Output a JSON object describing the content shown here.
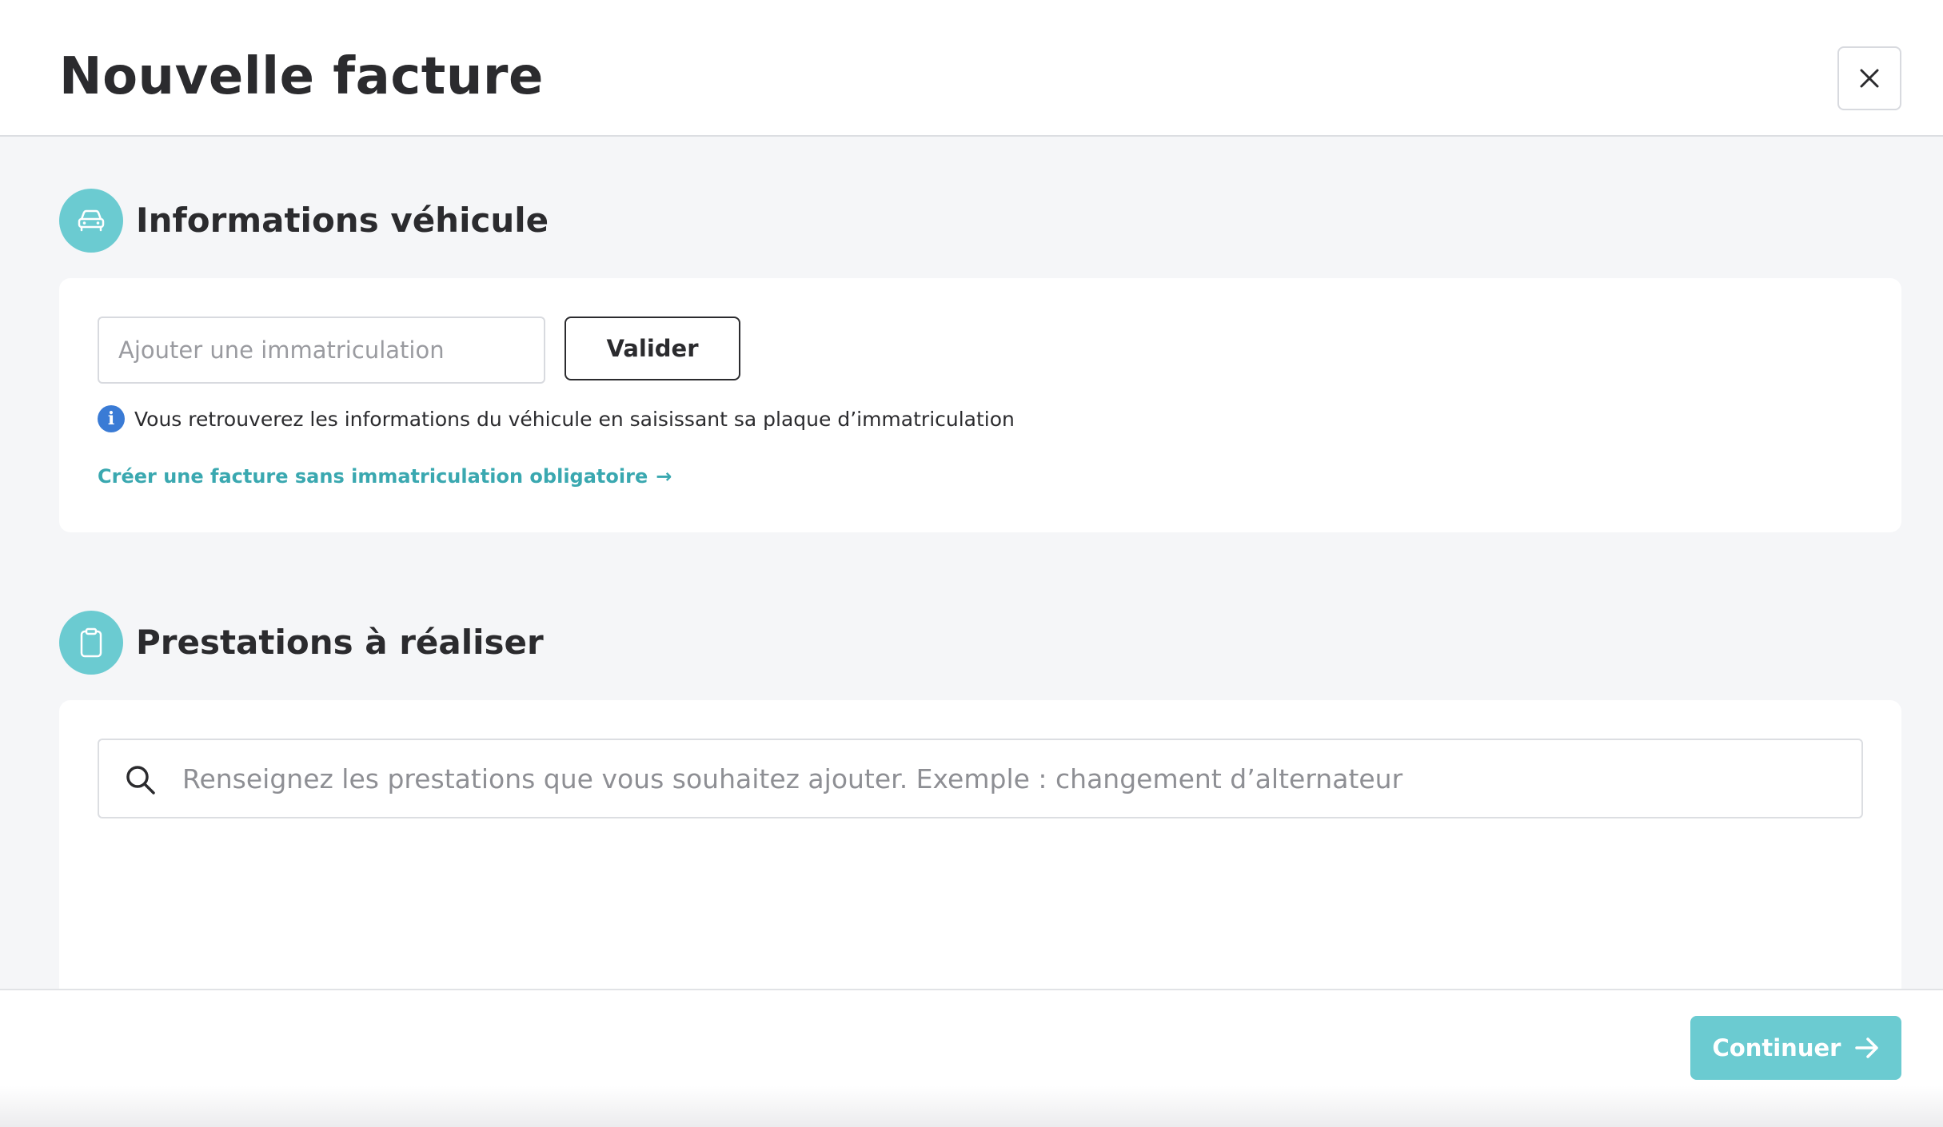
{
  "header": {
    "title": "Nouvelle facture",
    "close_icon": "close-icon"
  },
  "vehicle_section": {
    "icon": "car-icon",
    "title": "Informations véhicule",
    "plate_placeholder": "Ajouter une immatriculation",
    "plate_value": "",
    "validate_label": "Valider",
    "info_icon": "info-icon",
    "info_text": "Vous retrouverez les informations du véhicule en saisissant sa plaque d’immatriculation",
    "no_plate_link": "Créer une facture sans immatriculation obligatoire",
    "no_plate_link_arrow": "→"
  },
  "services_section": {
    "icon": "clipboard-icon",
    "title": "Prestations à réaliser",
    "search_icon": "search-icon",
    "search_placeholder": "Renseignez les prestations que vous souhaitez ajouter. Exemple : changement d’alternateur",
    "search_value": ""
  },
  "footer": {
    "continue_label": "Continuer",
    "continue_icon": "arrow-right-icon"
  },
  "colors": {
    "accent": "#6bcbd1",
    "link": "#3aa8b0",
    "info": "#3a7bd5",
    "background": "#f5f6f8",
    "text": "#2b2b2e"
  }
}
